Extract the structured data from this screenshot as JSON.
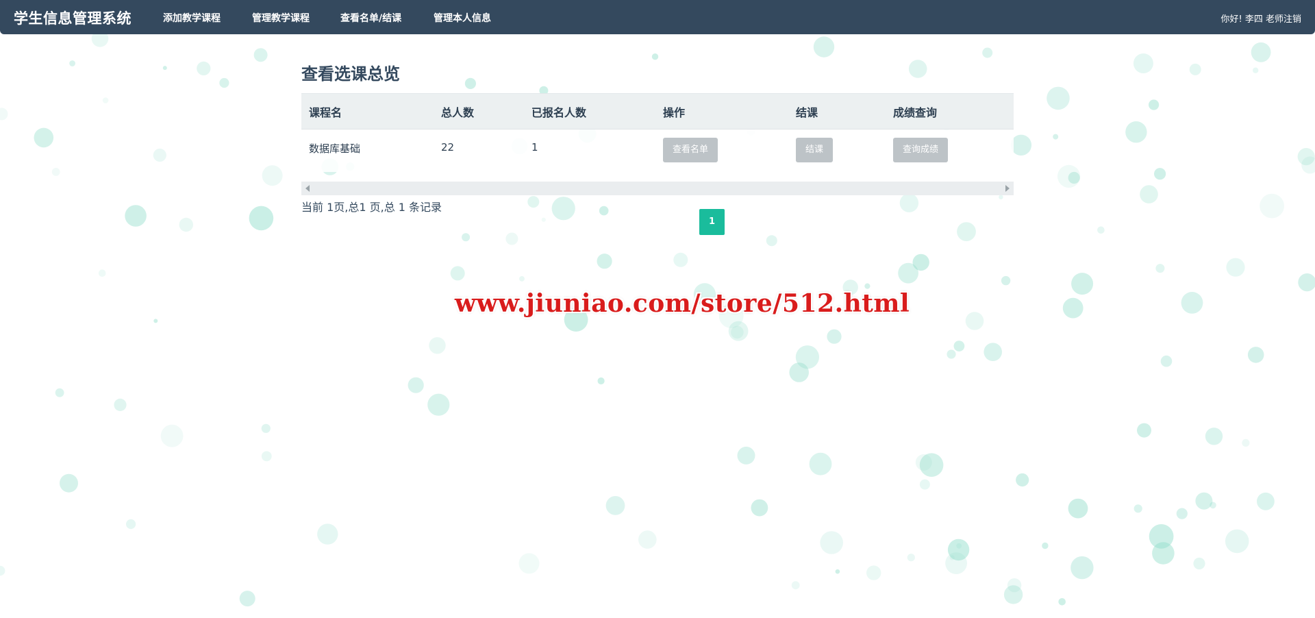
{
  "app": {
    "title": "学生信息管理系统"
  },
  "nav": {
    "items": [
      {
        "label": "添加教学课程"
      },
      {
        "label": "管理教学课程"
      },
      {
        "label": "查看名单/结课"
      },
      {
        "label": "管理本人信息"
      }
    ],
    "greeting": "你好! 李四 老师",
    "logout_label": "注销"
  },
  "page": {
    "title": "查看选课总览"
  },
  "table": {
    "headers": [
      "课程名",
      "总人数",
      "已报名人数",
      "操作",
      "结课",
      "成绩查询"
    ],
    "rows": [
      {
        "course_name": "数据库基础",
        "total": "22",
        "enrolled": "1",
        "view_list_label": "查看名单",
        "finish_label": "结课",
        "grades_label": "查询成绩"
      }
    ]
  },
  "pagination": {
    "summary": "当前 1页,总1 页,总 1 条记录",
    "current_page": "1"
  },
  "watermark": {
    "text": "www.jiuniao.com/store/512.html"
  },
  "colors": {
    "navbar": "#34495e",
    "accent": "#1abc9c",
    "button_disabled": "#bdc3c7",
    "watermark": "#d91c1c"
  }
}
